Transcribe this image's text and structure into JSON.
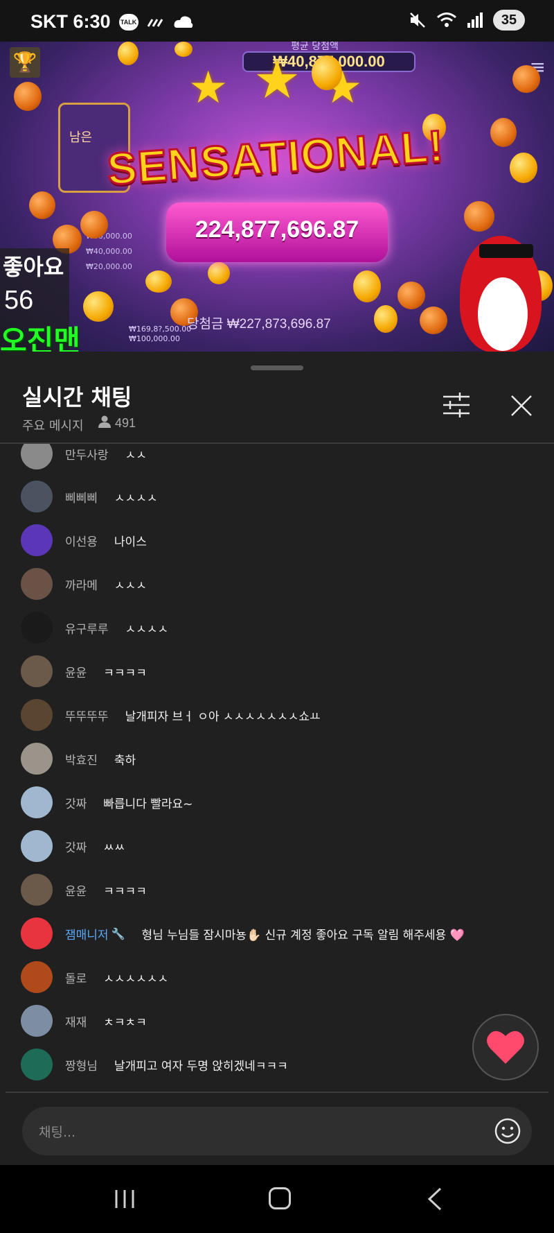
{
  "status_bar": {
    "carrier_time": "SKT 6:30",
    "talk_icon_label": "TALK",
    "battery": "35"
  },
  "video": {
    "top_label": "평균 당첨액",
    "top_amount": "₩40,875,000.00",
    "side_panel_text": "남은",
    "side_values": [
      "₩60,000.00",
      "₩40,000.00",
      "₩20,000.00"
    ],
    "headline": "SENSATIONAL!",
    "win_amount": "224,877,696.87",
    "bottom_win": "당첨금 ₩227,873,696.87",
    "bottom_values": [
      "₩169,8?,500.00",
      "₩100,000.00"
    ],
    "like_label": "좋아요",
    "like_count": "56",
    "streamer_tag": "오진맨"
  },
  "chat": {
    "title": "실시간 채팅",
    "subtitle": "주요 메시지",
    "viewer_count": "491",
    "messages": [
      {
        "author": "만두사랑",
        "text": "ㅅㅅ",
        "avatar_color": "#8a8a8a",
        "mod": false
      },
      {
        "author": "삐삐삐",
        "text": "ㅅㅅㅅㅅ",
        "avatar_color": "#4b5360",
        "mod": false
      },
      {
        "author": "이선용",
        "text": "나이스",
        "avatar_color": "#5b36b8",
        "mod": false
      },
      {
        "author": "까라메",
        "text": "ㅅㅅㅅ",
        "avatar_color": "#6a5246",
        "mod": false
      },
      {
        "author": "유구루루",
        "text": "ㅅㅅㅅㅅ",
        "avatar_color": "#1a1a1a",
        "mod": false
      },
      {
        "author": "윤윤",
        "text": "ㅋㅋㅋㅋ",
        "avatar_color": "#6b5a4a",
        "mod": false
      },
      {
        "author": "뚜뚜뚜뚜",
        "text": "날개피자 브ㅓ ㅇ아 ㅅㅅㅅㅅㅅㅅㅅ쇼ㅛ",
        "avatar_color": "#5a4630",
        "mod": false
      },
      {
        "author": "박효진",
        "text": "축하",
        "avatar_color": "#9a948a",
        "mod": false
      },
      {
        "author": "갓짜",
        "text": "빠릅니다 빨라요~",
        "avatar_color": "#9fb8d0",
        "mod": false
      },
      {
        "author": "갓짜",
        "text": "ㅆㅆ",
        "avatar_color": "#9fb8d0",
        "mod": false
      },
      {
        "author": "윤윤",
        "text": "ㅋㅋㅋㅋ",
        "avatar_color": "#6b5a4a",
        "mod": false
      },
      {
        "author": "잼매니저",
        "text": "형님 누님들 잠시마뇽✋🏻 신규 계정 좋아요 구독 알림 해주세용 🩷",
        "avatar_color": "#e8343e",
        "mod": true
      },
      {
        "author": "돌로",
        "text": "ㅅㅅㅅㅅㅅㅅ",
        "avatar_color": "#b04a1a",
        "mod": false
      },
      {
        "author": "재재",
        "text": "ㅊㅋㅊㅋ",
        "avatar_color": "#7d8ea4",
        "mod": false
      },
      {
        "author": "짱형님",
        "text": "날개피고 여자 두명 앉히겠네ㅋㅋㅋ",
        "avatar_color": "#1e6b58",
        "mod": false
      }
    ],
    "input_placeholder": "채팅..."
  },
  "colors": {
    "background": "#202020",
    "moderator_name": "#5aa9ff",
    "heart": "#ff4a6e"
  },
  "icons": {
    "filter": "tune-sliders-icon",
    "close": "close-icon",
    "viewers": "person-icon",
    "emoji": "smiley-icon",
    "heart": "heart-icon"
  }
}
